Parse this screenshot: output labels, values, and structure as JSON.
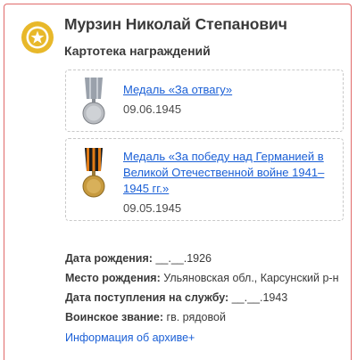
{
  "person": {
    "name": "Мурзин Николай Степанович"
  },
  "section": {
    "title": "Картотека награждений"
  },
  "awards": [
    {
      "title": "Медаль «За отвагу»",
      "date": "09.06.1945",
      "icon": "medal-for-courage-icon"
    },
    {
      "title": "Медаль «За победу над Германией в Великой Отечественной войне 1941–1945 гг.»",
      "date": "09.05.1945",
      "icon": "medal-victory-over-germany-icon"
    }
  ],
  "details": {
    "birth_date_label": "Дата рождения:",
    "birth_date_value": "__.__.1926",
    "birth_place_label": "Место рождения:",
    "birth_place_value": "Ульяновская обл., Карсунский р-н",
    "service_date_label": "Дата поступления на службу:",
    "service_date_value": "__.__.1943",
    "rank_label": "Воинское звание:",
    "rank_value": "гв. рядовой"
  },
  "archive": {
    "link_label": "Информация об архиве+"
  },
  "colors": {
    "card_border": "#e06a6a",
    "badge": "#e8b82a",
    "link": "#1a5fd6"
  }
}
